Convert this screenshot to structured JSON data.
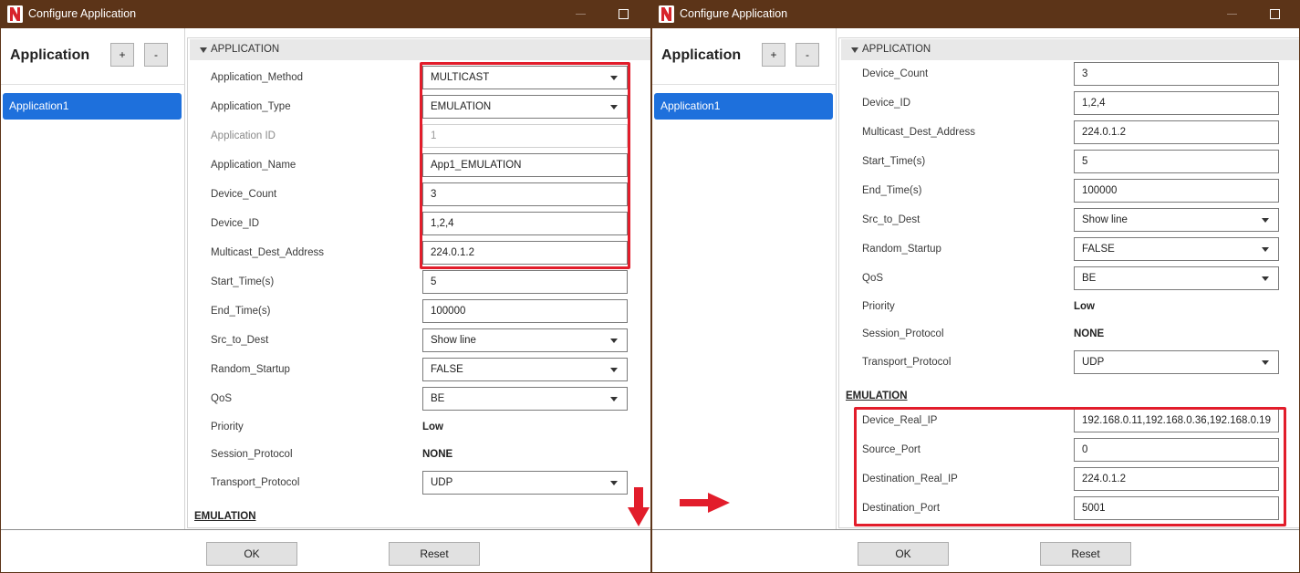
{
  "colors": {
    "titlebar": "#5c3418",
    "selection": "#1e70dc",
    "annotation": "#e21d2b",
    "section_header": "#e8e8e8"
  },
  "icons": {
    "logo": "app-logo-icon",
    "minimize": "minimize-icon",
    "maximize": "maximize-icon",
    "dropdown": "chevron-down-icon",
    "collapse": "collapse-triangle-icon",
    "annotation_arrows": [
      "arrow-down-icon",
      "arrow-right-icon"
    ]
  },
  "dialogs": [
    {
      "title": "Configure Application",
      "sidebar": {
        "header": "Application",
        "add_label": "+",
        "remove_label": "-",
        "items": [
          "Application1"
        ]
      },
      "section_title": "APPLICATION",
      "rows": [
        {
          "label": "Application_Method",
          "select": "MULTICAST"
        },
        {
          "label": "Application_Type",
          "select": "EMULATION"
        },
        {
          "label": "Application ID",
          "disabled_input": "1"
        },
        {
          "label": "Application_Name",
          "input": "App1_EMULATION"
        },
        {
          "label": "Device_Count",
          "input": "3"
        },
        {
          "label": "Device_ID",
          "input": "1,2,4"
        },
        {
          "label": "Multicast_Dest_Address",
          "input": "224.0.1.2"
        },
        {
          "label": "Start_Time(s)",
          "input": "5"
        },
        {
          "label": "End_Time(s)",
          "input": "100000"
        },
        {
          "label": "Src_to_Dest",
          "select": "Show line"
        },
        {
          "label": "Random_Startup",
          "select": "FALSE"
        },
        {
          "label": "QoS",
          "select": "BE"
        },
        {
          "label": "Priority",
          "text": "Low"
        },
        {
          "label": "Session_Protocol",
          "text": "NONE"
        },
        {
          "label": "Transport_Protocol",
          "select": "UDP"
        },
        {
          "heading": "EMULATION"
        }
      ],
      "footer": {
        "ok_label": "OK",
        "reset_label": "Reset"
      }
    },
    {
      "title": "Configure Application",
      "sidebar": {
        "header": "Application",
        "add_label": "+",
        "remove_label": "-",
        "items": [
          "Application1"
        ]
      },
      "section_title": "APPLICATION",
      "rows": [
        {
          "label": "Device_Count",
          "input": "3"
        },
        {
          "label": "Device_ID",
          "input": "1,2,4"
        },
        {
          "label": "Multicast_Dest_Address",
          "input": "224.0.1.2"
        },
        {
          "label": "Start_Time(s)",
          "input": "5"
        },
        {
          "label": "End_Time(s)",
          "input": "100000"
        },
        {
          "label": "Src_to_Dest",
          "select": "Show line"
        },
        {
          "label": "Random_Startup",
          "select": "FALSE"
        },
        {
          "label": "QoS",
          "select": "BE"
        },
        {
          "label": "Priority",
          "text": "Low"
        },
        {
          "label": "Session_Protocol",
          "text": "NONE"
        },
        {
          "label": "Transport_Protocol",
          "select": "UDP"
        },
        {
          "heading": "EMULATION"
        },
        {
          "label": "Device_Real_IP",
          "input": "192.168.0.11,192.168.0.36,192.168.0.19"
        },
        {
          "label": "Source_Port",
          "input": "0"
        },
        {
          "label": "Destination_Real_IP",
          "input": "224.0.1.2"
        },
        {
          "label": "Destination_Port",
          "input": "5001"
        }
      ],
      "footer": {
        "ok_label": "OK",
        "reset_label": "Reset"
      }
    }
  ]
}
